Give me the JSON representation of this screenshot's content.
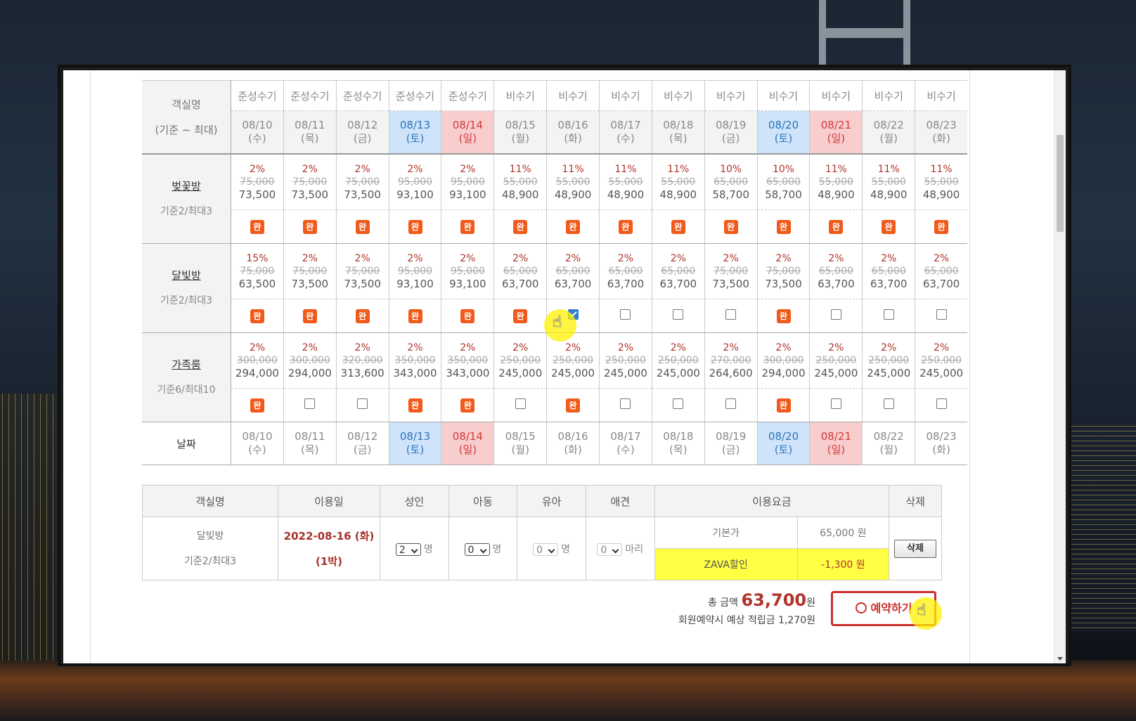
{
  "calendar": {
    "header_label": "객실명",
    "header_sub": "(기준 ~ 최대)",
    "seasons": [
      "준성수기",
      "준성수기",
      "준성수기",
      "준성수기",
      "준성수기",
      "비수기",
      "비수기",
      "비수기",
      "비수기",
      "비수기",
      "비수기",
      "비수기",
      "비수기",
      "비수기"
    ],
    "dates": [
      {
        "date": "08/10",
        "dow": "(수)",
        "type": "weekday"
      },
      {
        "date": "08/11",
        "dow": "(목)",
        "type": "weekday"
      },
      {
        "date": "08/12",
        "dow": "(금)",
        "type": "weekday"
      },
      {
        "date": "08/13",
        "dow": "(토)",
        "type": "sat"
      },
      {
        "date": "08/14",
        "dow": "(일)",
        "type": "sun"
      },
      {
        "date": "08/15",
        "dow": "(월)",
        "type": "weekday"
      },
      {
        "date": "08/16",
        "dow": "(화)",
        "type": "weekday"
      },
      {
        "date": "08/17",
        "dow": "(수)",
        "type": "weekday"
      },
      {
        "date": "08/18",
        "dow": "(목)",
        "type": "weekday"
      },
      {
        "date": "08/19",
        "dow": "(금)",
        "type": "weekday"
      },
      {
        "date": "08/20",
        "dow": "(토)",
        "type": "sat"
      },
      {
        "date": "08/21",
        "dow": "(일)",
        "type": "sun"
      },
      {
        "date": "08/22",
        "dow": "(월)",
        "type": "weekday"
      },
      {
        "date": "08/23",
        "dow": "(화)",
        "type": "weekday"
      }
    ],
    "rooms": [
      {
        "name": "벚꽃방",
        "capacity": "기준2/최대3",
        "pct": [
          "2%",
          "2%",
          "2%",
          "2%",
          "2%",
          "11%",
          "11%",
          "11%",
          "11%",
          "10%",
          "10%",
          "11%",
          "11%",
          "11%"
        ],
        "orig": [
          "75,000",
          "75,000",
          "75,000",
          "95,000",
          "95,000",
          "55,000",
          "55,000",
          "55,000",
          "55,000",
          "65,000",
          "65,000",
          "55,000",
          "55,000",
          "55,000"
        ],
        "final": [
          "73,500",
          "73,500",
          "73,500",
          "93,100",
          "93,100",
          "48,900",
          "48,900",
          "48,900",
          "48,900",
          "58,700",
          "58,700",
          "48,900",
          "48,900",
          "48,900"
        ],
        "status": [
          "full",
          "full",
          "full",
          "full",
          "full",
          "full",
          "full",
          "full",
          "full",
          "full",
          "full",
          "full",
          "full",
          "full"
        ]
      },
      {
        "name": "달빛방",
        "capacity": "기준2/최대3",
        "pct": [
          "15%",
          "2%",
          "2%",
          "2%",
          "2%",
          "2%",
          "2%",
          "2%",
          "2%",
          "2%",
          "2%",
          "2%",
          "2%",
          "2%"
        ],
        "orig": [
          "75,000",
          "75,000",
          "75,000",
          "95,000",
          "95,000",
          "65,000",
          "65,000",
          "65,000",
          "65,000",
          "75,000",
          "75,000",
          "65,000",
          "65,000",
          "65,000"
        ],
        "final": [
          "63,500",
          "73,500",
          "73,500",
          "93,100",
          "93,100",
          "63,700",
          "63,700",
          "63,700",
          "63,700",
          "73,500",
          "73,500",
          "63,700",
          "63,700",
          "63,700"
        ],
        "status": [
          "full",
          "full",
          "full",
          "full",
          "full",
          "full",
          "checked",
          "open",
          "open",
          "open",
          "full",
          "open",
          "open",
          "open"
        ]
      },
      {
        "name": "가족룸",
        "capacity": "기준6/최대10",
        "pct": [
          "2%",
          "2%",
          "2%",
          "2%",
          "2%",
          "2%",
          "2%",
          "2%",
          "2%",
          "2%",
          "2%",
          "2%",
          "2%",
          "2%"
        ],
        "orig": [
          "300,000",
          "300,000",
          "320,000",
          "350,000",
          "350,000",
          "250,000",
          "250,000",
          "250,000",
          "250,000",
          "270,000",
          "300,000",
          "250,000",
          "250,000",
          "250,000"
        ],
        "final": [
          "294,000",
          "294,000",
          "313,600",
          "343,000",
          "343,000",
          "245,000",
          "245,000",
          "245,000",
          "245,000",
          "264,600",
          "294,000",
          "245,000",
          "245,000",
          "245,000"
        ],
        "status": [
          "full",
          "open",
          "open",
          "full",
          "full",
          "open",
          "full",
          "open",
          "open",
          "open",
          "full",
          "open",
          "open",
          "open"
        ]
      }
    ],
    "full_label": "완",
    "footer_label": "날짜"
  },
  "summary": {
    "headers": {
      "room": "객실명",
      "date": "이용일",
      "adult": "성인",
      "child": "아동",
      "infant": "유아",
      "pet": "애견",
      "fee": "이용요금",
      "delete": "삭제"
    },
    "room_name": "달빛방",
    "room_capacity": "기준2/최대3",
    "use_date": "2022-08-16 (화)",
    "nights": "(1박)",
    "adult_value": "2",
    "adult_unit": "명",
    "child_value": "0",
    "child_unit": "명",
    "infant_value": "0",
    "infant_unit": "명",
    "pet_value": "0",
    "pet_unit": "마리",
    "base_label": "기본가",
    "base_amount": "65,000 원",
    "discount_label": "ZAVA할인",
    "discount_amount": "-1,300 원",
    "delete_label": "삭제"
  },
  "totals": {
    "total_label": "총 금액",
    "total_amount": "63,700",
    "total_unit": "원",
    "points_text": "회원예약시 예상 적립금 1,270원",
    "book_label": "예약하기"
  },
  "colors": {
    "accent": "#c9302c",
    "full_badge": "#f05a1a",
    "saturday": "#cfe3fa",
    "sunday": "#f8cdcd",
    "highlight": "#ffff44"
  }
}
